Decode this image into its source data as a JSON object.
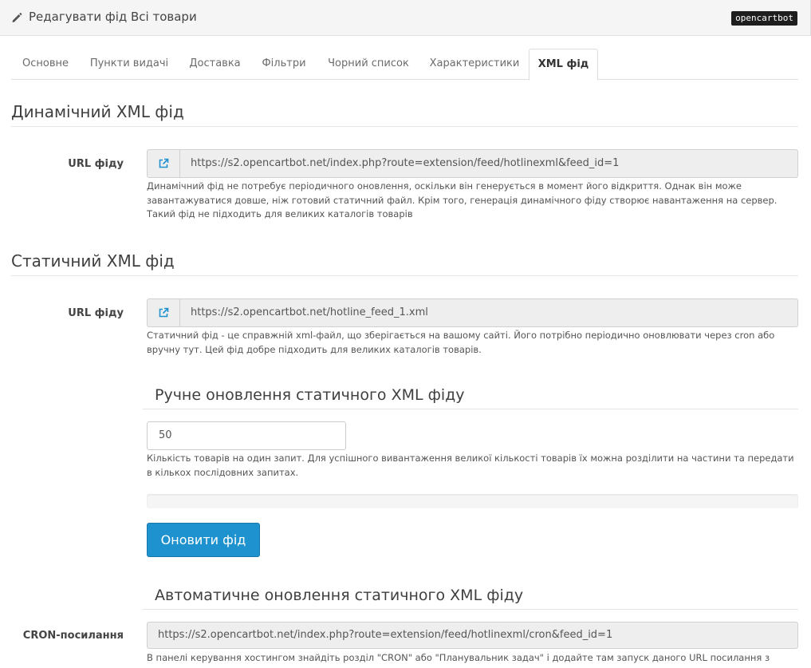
{
  "header": {
    "title": "Редагувати фід Всі товари",
    "brand": "opencartbot"
  },
  "tabs": [
    {
      "label": "Основне"
    },
    {
      "label": "Пункти видачі"
    },
    {
      "label": "Доставка"
    },
    {
      "label": "Фільтри"
    },
    {
      "label": "Чорний список"
    },
    {
      "label": "Характеристики"
    },
    {
      "label": "XML фід",
      "active": true
    }
  ],
  "dynamic": {
    "title": "Динамічний XML фід",
    "url_label": "URL фіду",
    "url": "https://s2.opencartbot.net/index.php?route=extension/feed/hotlinexml&feed_id=1",
    "help": "Динамічний фід не потребує періодичного оновлення, оскільки він генерується в момент його відкриття. Однак він може завантажуватися довше, ніж готовий статичний файл. Крім того, генерація динамічного фіду створює навантаження на сервер. Такий фід не підходить для великих каталогів товарів"
  },
  "static": {
    "title": "Статичний XML фід",
    "url_label": "URL фіду",
    "url": "https://s2.opencartbot.net/hotline_feed_1.xml",
    "help": "Статичний фід - це справжній xml-файл, що зберігається на вашому сайті. Його потрібно періодично оновлювати через cron або вручну тут. Цей фід добре підходить для великих каталогів товарів."
  },
  "manual": {
    "title": "Ручне оновлення статичного XML фіду",
    "quantity": "50",
    "help": "Кількість товарів на один запит. Для успішного вивантаження великої кількості товарів їх можна розділити на частини та передати в кількох послідовних запитах.",
    "progress": 0,
    "button": "Оновити фід"
  },
  "auto": {
    "title": "Автоматичне оновлення статичного XML фіду",
    "cron_label": "CRON-посилання",
    "cron_url": "https://s2.opencartbot.net/index.php?route=extension/feed/hotlinexml/cron&feed_id=1",
    "help": "В панелі керування хостингом знайдіть розділ \"CRON\" або \"Планувальник задач\" і додайте там запуск даного URL посилання з"
  },
  "colors": {
    "primary": "#1e91cf",
    "link_icon": "#1e91cf"
  }
}
